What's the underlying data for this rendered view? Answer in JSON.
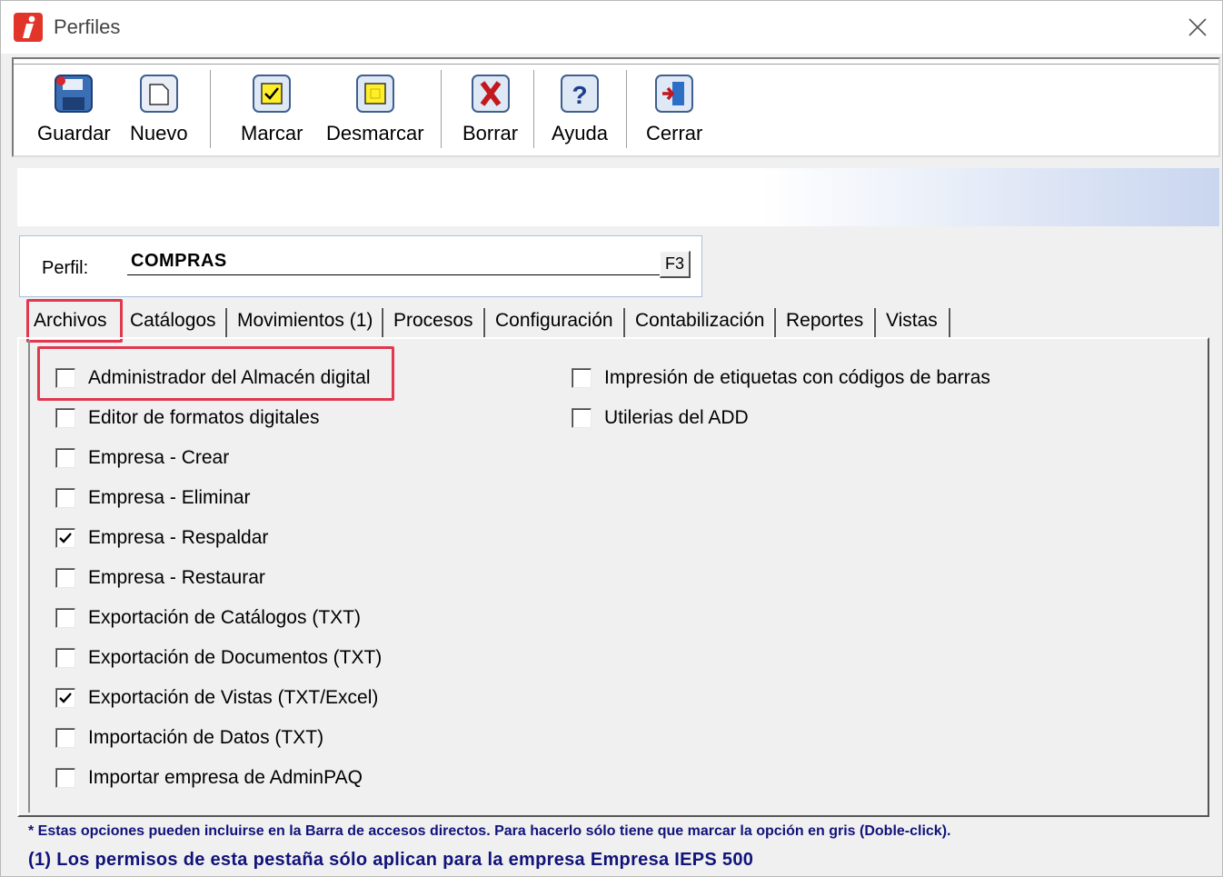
{
  "window": {
    "title": "Perfiles"
  },
  "toolbar": {
    "buttons": [
      {
        "label": "Guardar",
        "icon": "save-icon"
      },
      {
        "label": "Nuevo",
        "icon": "new-document-icon"
      },
      {
        "label": "Marcar",
        "icon": "check-mark-icon"
      },
      {
        "label": "Desmarcar",
        "icon": "uncheck-icon"
      },
      {
        "label": "Borrar",
        "icon": "delete-x-icon"
      },
      {
        "label": "Ayuda",
        "icon": "help-icon"
      },
      {
        "label": "Cerrar",
        "icon": "exit-door-icon"
      }
    ]
  },
  "perfil": {
    "label": "Perfil:",
    "value": "COMPRAS",
    "lookup_button": "F3"
  },
  "tabs": [
    {
      "label": "Archivos",
      "active": true
    },
    {
      "label": "Catálogos"
    },
    {
      "label": "Movimientos (1)"
    },
    {
      "label": "Procesos"
    },
    {
      "label": "Configuración"
    },
    {
      "label": "Contabilización"
    },
    {
      "label": "Reportes"
    },
    {
      "label": "Vistas"
    }
  ],
  "options_left": [
    {
      "label": "Administrador del Almacén digital",
      "checked": false
    },
    {
      "label": "Editor de formatos digitales",
      "checked": false
    },
    {
      "label": "Empresa - Crear",
      "checked": false
    },
    {
      "label": "Empresa - Eliminar",
      "checked": false
    },
    {
      "label": "Empresa - Respaldar",
      "checked": true
    },
    {
      "label": "Empresa - Restaurar",
      "checked": false
    },
    {
      "label": "Exportación de Catálogos (TXT)",
      "checked": false
    },
    {
      "label": "Exportación de Documentos (TXT)",
      "checked": false
    },
    {
      "label": "Exportación de Vistas (TXT/Excel)",
      "checked": true
    },
    {
      "label": "Importación de Datos (TXT)",
      "checked": false
    },
    {
      "label": "Importar empresa de AdminPAQ",
      "checked": false
    }
  ],
  "options_right": [
    {
      "label": "Impresión de etiquetas con códigos de barras",
      "checked": false
    },
    {
      "label": "Utilerias del ADD",
      "checked": false
    }
  ],
  "footer": {
    "note1": "* Estas opciones pueden incluirse en la Barra de accesos directos. Para hacerlo sólo tiene que marcar la opción en gris (Doble-click).",
    "note2": "(1) Los permisos de esta pestaña sólo aplican para la empresa Empresa IEPS 500"
  },
  "colors": {
    "highlight": "#e0384f",
    "note_text": "#10137a",
    "app_icon": "#e2352a"
  }
}
